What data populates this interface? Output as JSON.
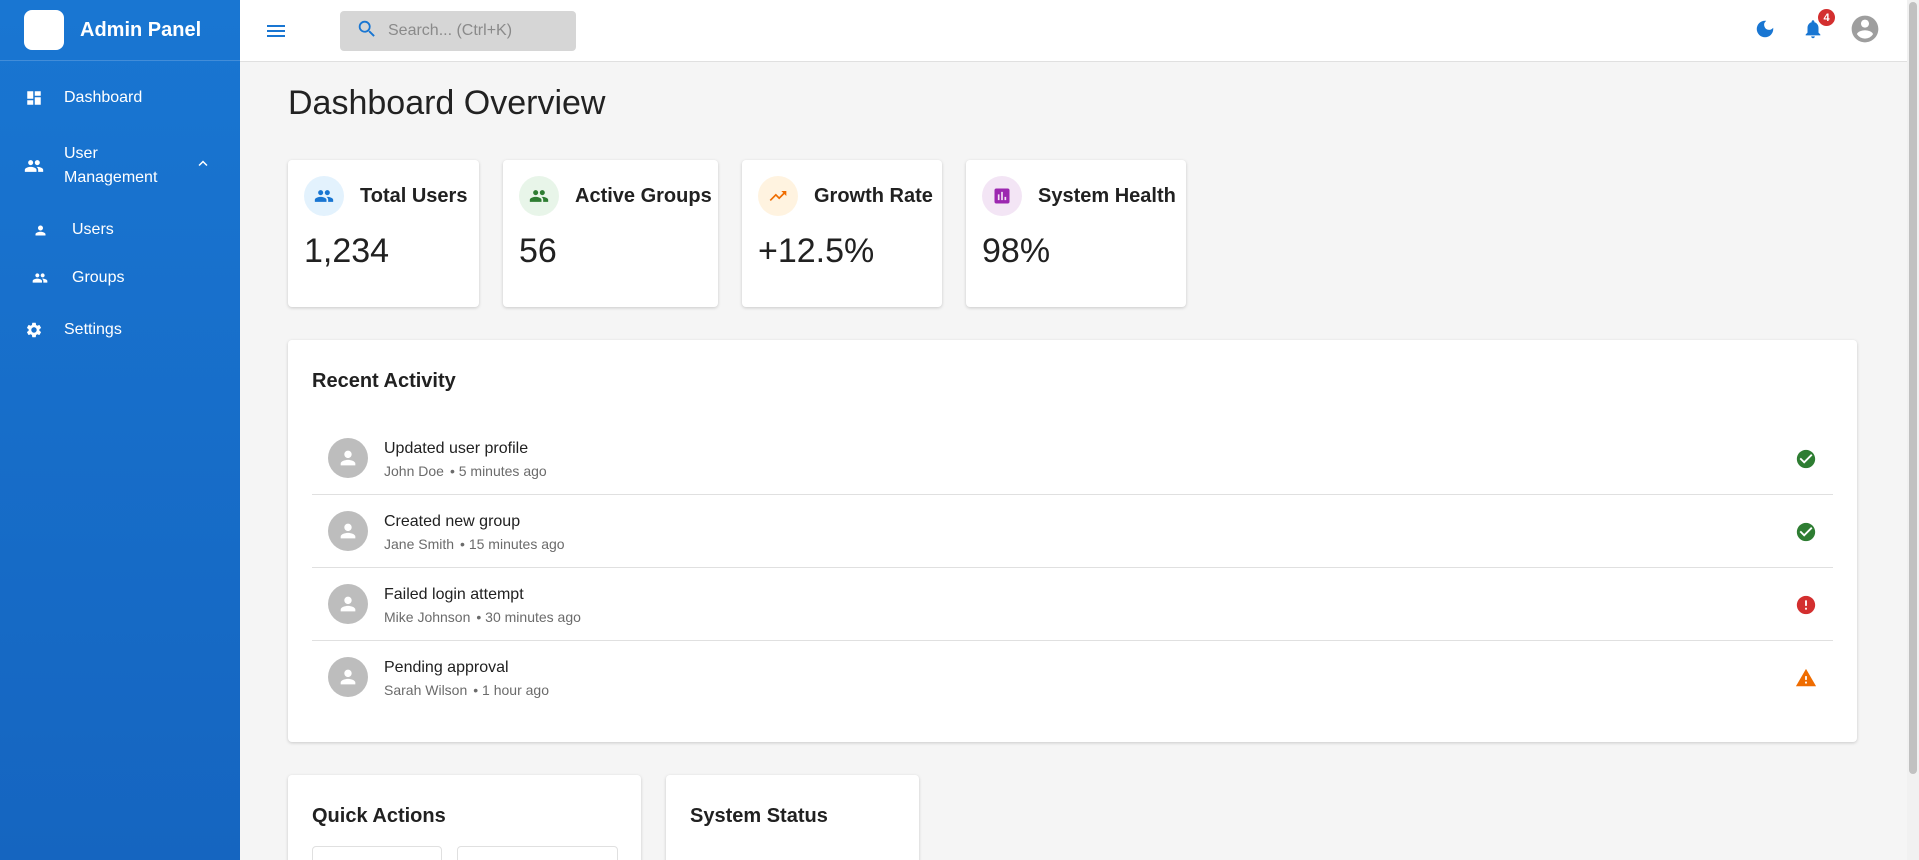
{
  "app": {
    "title": "Admin Panel"
  },
  "sidebar": {
    "items": [
      {
        "label": "Dashboard",
        "icon": "dashboard-icon"
      },
      {
        "label": "User\nManagement",
        "icon": "people-icon",
        "expanded": true
      },
      {
        "label": "Users",
        "icon": "person-icon"
      },
      {
        "label": "Groups",
        "icon": "group-icon"
      },
      {
        "label": "Settings",
        "icon": "gear-icon"
      }
    ]
  },
  "topbar": {
    "search_placeholder": "Search... (Ctrl+K)",
    "notification_count": "4"
  },
  "main": {
    "title": "Dashboard Overview",
    "stats": [
      {
        "label": "Total Users",
        "value": "1,234",
        "icon": "people-icon",
        "color": "#1976d2"
      },
      {
        "label": "Active Groups",
        "value": "56",
        "icon": "group-icon",
        "color": "#2e7d32"
      },
      {
        "label": "Growth Rate",
        "value": "+12.5%",
        "icon": "trending-up-icon",
        "color": "#ef6c00"
      },
      {
        "label": "System Health",
        "value": "98%",
        "icon": "bar-chart-icon",
        "color": "#9c27b0"
      }
    ],
    "recent_activity": {
      "title": "Recent Activity",
      "items": [
        {
          "action": "Updated user profile",
          "user": "John Doe",
          "time": "• 5 minutes ago",
          "status": "success"
        },
        {
          "action": "Created new group",
          "user": "Jane Smith",
          "time": "• 15 minutes ago",
          "status": "success"
        },
        {
          "action": "Failed login attempt",
          "user": "Mike Johnson",
          "time": "• 30 minutes ago",
          "status": "error"
        },
        {
          "action": "Pending approval",
          "user": "Sarah Wilson",
          "time": "• 1 hour ago",
          "status": "warning"
        }
      ]
    },
    "quick_actions": {
      "title": "Quick Actions"
    },
    "system_status": {
      "title": "System Status"
    }
  },
  "colors": {
    "primary": "#1976d2",
    "success": "#2e7d32",
    "error": "#d32f2f",
    "warning": "#ef6c00"
  }
}
